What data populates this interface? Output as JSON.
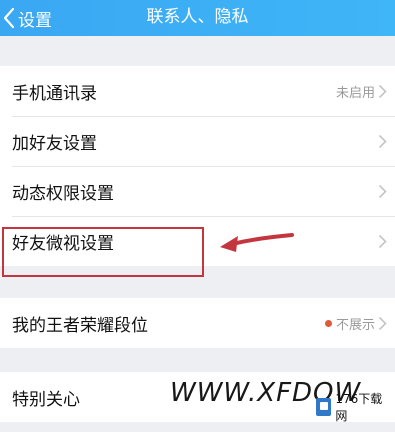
{
  "header": {
    "back_label": "设置",
    "title": "联系人、隐私"
  },
  "groups": [
    {
      "items": [
        {
          "label": "手机通讯录",
          "value": "未启用"
        },
        {
          "label": "加好友设置"
        },
        {
          "label": "动态权限设置"
        },
        {
          "label": "好友微视设置"
        }
      ]
    },
    {
      "items": [
        {
          "label": "我的王者荣耀段位",
          "value": "不展示",
          "status_color": "#e05a3a"
        }
      ]
    },
    {
      "items": [
        {
          "label": "特别关心"
        }
      ]
    }
  ],
  "annotation": {
    "highlight_color": "#c4363f"
  },
  "watermark": {
    "text": "WWW.XFDOW",
    "logo_text": "176下载网"
  },
  "colors": {
    "header_bg": "#3aa7f3",
    "page_bg": "#eeeff3"
  }
}
